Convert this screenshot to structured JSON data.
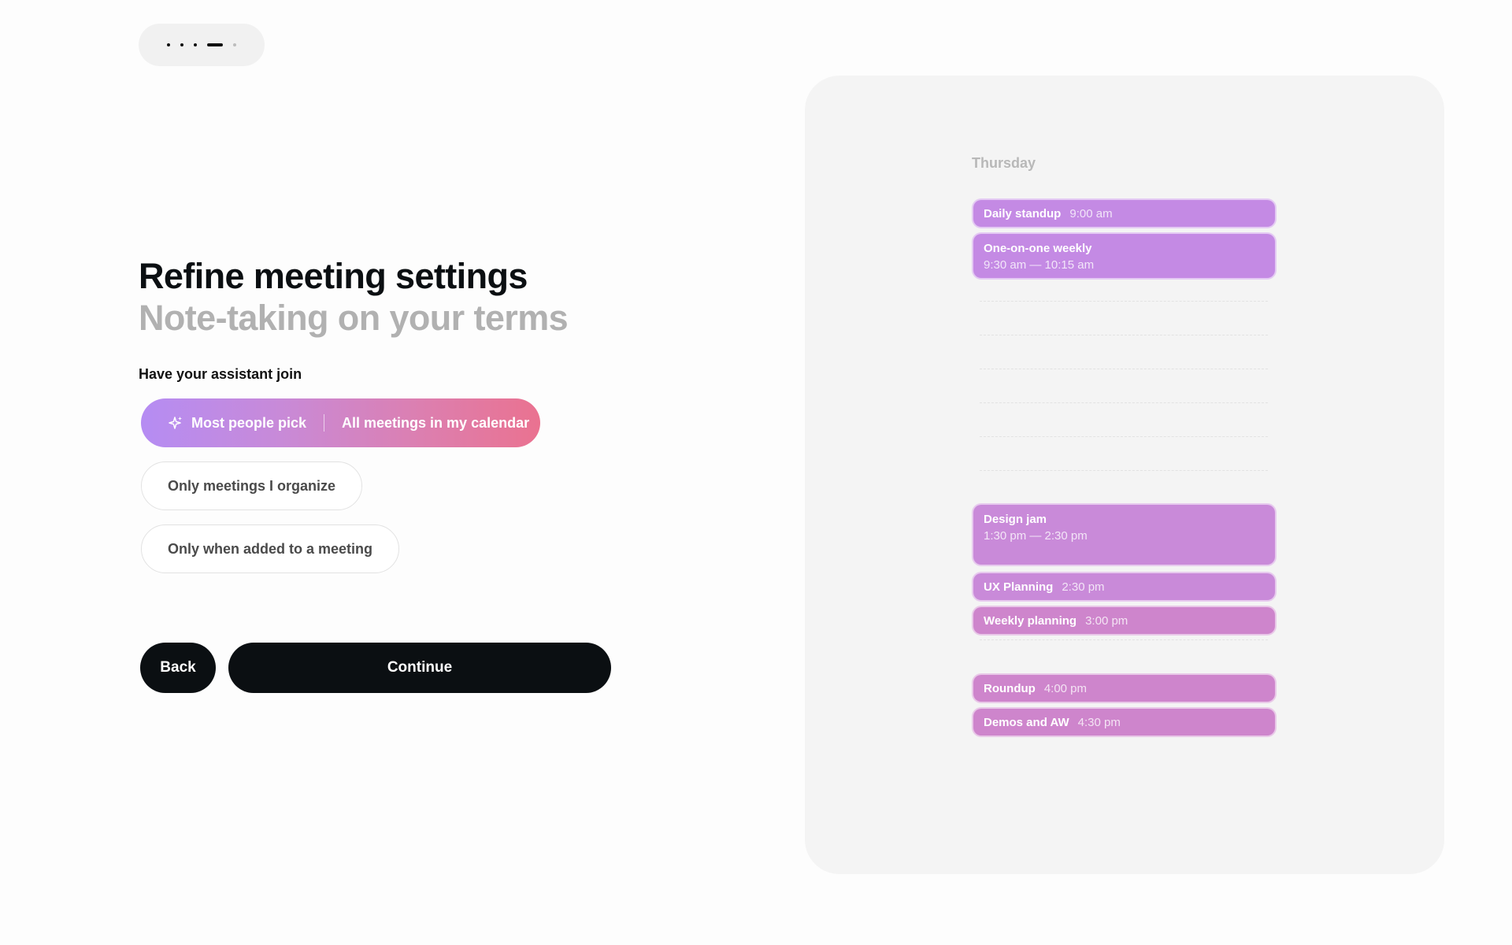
{
  "stepper": {
    "steps_total": 5,
    "current_step": 4
  },
  "heading": {
    "title": "Refine meeting settings",
    "subtitle": "Note-taking on your terms"
  },
  "join": {
    "label": "Have your assistant join",
    "recommended": {
      "badge": "Most people pick",
      "label": "All meetings in my calendar"
    },
    "options": [
      "Only meetings I organize",
      "Only when added to a meeting"
    ]
  },
  "buttons": {
    "back": "Back",
    "continue": "Continue"
  },
  "calendar": {
    "day": "Thursday",
    "events": [
      {
        "title": "Daily standup",
        "time": "9:00 am"
      },
      {
        "title": "One-on-one weekly",
        "time": "9:30 am — 10:15 am"
      },
      {
        "title": "Design jam",
        "time": "1:30 pm — 2:30 pm"
      },
      {
        "title": "UX Planning",
        "time": "2:30 pm"
      },
      {
        "title": "Weekly planning",
        "time": "3:00 pm"
      },
      {
        "title": "Roundup",
        "time": "4:00 pm"
      },
      {
        "title": "Demos and AW",
        "time": "4:30 pm"
      }
    ]
  },
  "colors": {
    "accent_gradient_start": "#b58cf3",
    "accent_gradient_end": "#ea7290",
    "event_purple": "#c48ae4",
    "event_pink": "#ce85cc",
    "button_dark": "#0b0f12"
  }
}
